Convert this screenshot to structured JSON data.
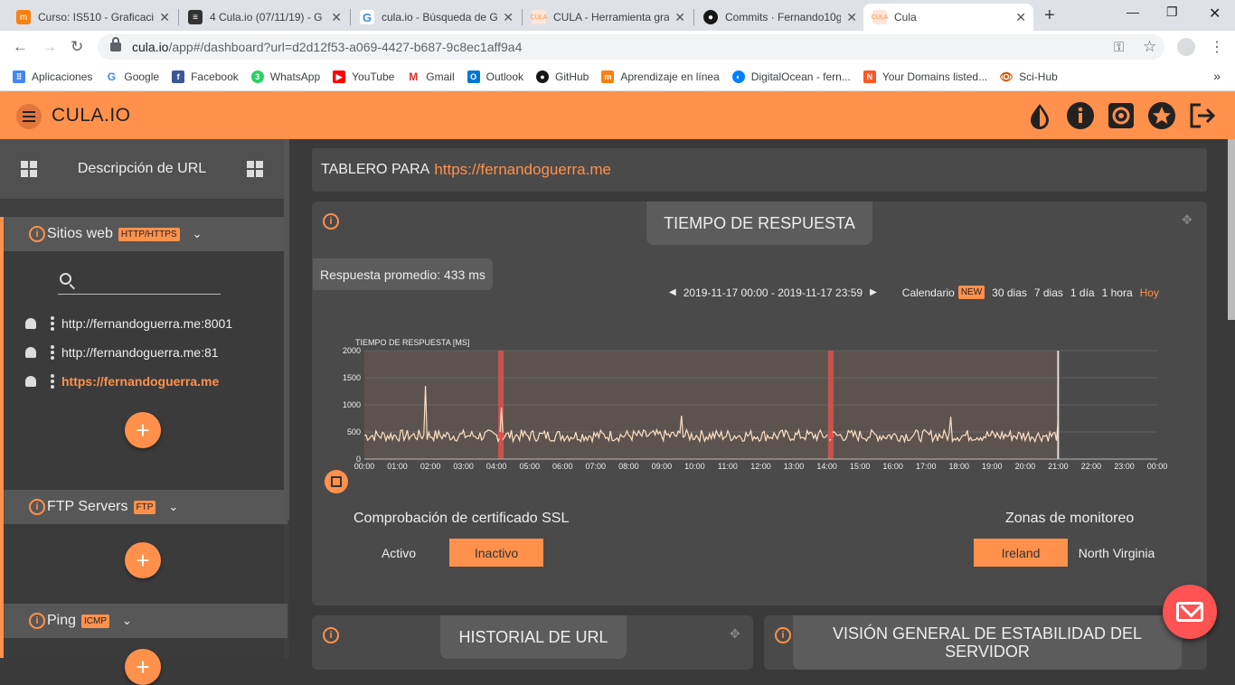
{
  "browser": {
    "tabs": [
      {
        "title": "Curso: IS510 - Graficació",
        "icon": "moodle-icon",
        "color": "#f98012"
      },
      {
        "title": "4 Cula.io (07/11/19) - G",
        "icon": "docs-icon",
        "color": "#333333"
      },
      {
        "title": "cula.io - Búsqueda de G",
        "icon": "google-icon",
        "color": "#4285f4"
      },
      {
        "title": "CULA - Herramienta gra",
        "icon": "cula-icon",
        "color": "#ff914d"
      },
      {
        "title": "Commits · Fernando10g",
        "icon": "github-icon",
        "color": "#181717"
      },
      {
        "title": "Cula",
        "icon": "cula-icon",
        "color": "#ff914d"
      }
    ],
    "url_host": "cula.io",
    "url_path": "/app#/dashboard?url=d2d12f53-a069-4427-b687-9c8ec1aff9a4",
    "bookmarks": [
      {
        "label": "Aplicaciones",
        "icon": "apps-grid-icon",
        "color": "#4285f4"
      },
      {
        "label": "Google",
        "icon": "google-icon",
        "color": "#4285f4"
      },
      {
        "label": "Facebook",
        "icon": "facebook-icon",
        "color": "#3b5998"
      },
      {
        "label": "WhatsApp",
        "icon": "whatsapp-icon",
        "color": "#25d366"
      },
      {
        "label": "YouTube",
        "icon": "youtube-icon",
        "color": "#ff0000"
      },
      {
        "label": "Gmail",
        "icon": "gmail-icon",
        "color": "#d93025"
      },
      {
        "label": "Outlook",
        "icon": "outlook-icon",
        "color": "#0078d4"
      },
      {
        "label": "GitHub",
        "icon": "github-icon",
        "color": "#181717"
      },
      {
        "label": "Aprendizaje en línea",
        "icon": "moodle-icon",
        "color": "#f98012"
      },
      {
        "label": "DigitalOcean - fern...",
        "icon": "digitalocean-icon",
        "color": "#0080ff"
      },
      {
        "label": "Your Domains listed...",
        "icon": "namecheap-icon",
        "color": "#ff5722"
      },
      {
        "label": "Sci-Hub",
        "icon": "scihub-icon",
        "color": "#d35400"
      }
    ],
    "bookmarks_more": "»"
  },
  "app": {
    "brand": "CULA.IO",
    "accent": "#ff914d",
    "toolbar_icons": [
      "theme-drop-icon",
      "info-icon",
      "settings-gear-icon",
      "star-icon",
      "logout-icon"
    ]
  },
  "sidebar": {
    "title": "Descripción de URL",
    "websites": {
      "title": "Sitios web",
      "badge": "HTTP/HTTPS",
      "items": [
        {
          "label": "http://fernandoguerra.me:8001",
          "active": false
        },
        {
          "label": "http://fernandoguerra.me:81",
          "active": false
        },
        {
          "label": "https://fernandoguerra.me",
          "active": true
        }
      ]
    },
    "ftp": {
      "title": "FTP Servers",
      "badge": "FTP"
    },
    "ping": {
      "title": "Ping",
      "badge": "ICMP"
    },
    "add_label": "+"
  },
  "dashboard": {
    "title_prefix": "TABLERO PARA",
    "title_url": "https://fernandoguerra.me",
    "response_card": {
      "title": "TIEMPO DE RESPUESTA",
      "average": "Respuesta promedio: 433 ms",
      "range_text": "2019-11-17 00:00 - 2019-11-17 23:59",
      "range_prev": "◀",
      "range_next": "▶",
      "calendar": "Calendario",
      "new_badge": "NEW",
      "ranges": [
        "30 dias",
        "7 dias",
        "1 día",
        "1 hora"
      ],
      "today": "Hoy",
      "ssl_heading": "Comprobación de certificado SSL",
      "ssl_options": [
        {
          "label": "Activo",
          "selected": false
        },
        {
          "label": "Inactivo",
          "selected": true
        }
      ],
      "zones_heading": "Zonas de monitoreo",
      "zone_options": [
        {
          "label": "Ireland",
          "selected": true
        },
        {
          "label": "North Virginia",
          "selected": false
        }
      ]
    },
    "history_card": {
      "title": "HISTORIAL DE URL"
    },
    "stability_card": {
      "title": "VISIÓN GENERAL DE ESTABILIDAD DEL SERVIDOR"
    }
  },
  "chart_data": {
    "type": "line",
    "title": "",
    "ylabel": "TIEMPO DE RESPUESTA [MS]",
    "xlabel": "",
    "ylim": [
      0,
      2000
    ],
    "yticks": [
      0,
      500,
      1000,
      1500,
      2000
    ],
    "xticks": [
      "00:00",
      "01:00",
      "02:00",
      "03:00",
      "04:00",
      "05:00",
      "06:00",
      "07:00",
      "08:00",
      "09:00",
      "10:00",
      "11:00",
      "12:00",
      "13:00",
      "14:00",
      "15:00",
      "16:00",
      "17:00",
      "18:00",
      "19:00",
      "20:00",
      "21:00",
      "22:00",
      "23:00",
      "00:00"
    ],
    "baseline_ms": 433,
    "spikes": [
      {
        "time": "01:50",
        "value": 1350
      },
      {
        "time": "04:10",
        "value": 950
      },
      {
        "time": "09:35",
        "value": 800
      },
      {
        "time": "17:45",
        "value": 780
      },
      {
        "time": "21:00",
        "value": 700
      }
    ],
    "incidents": [
      "04:08",
      "14:07"
    ],
    "data_end": "21:00",
    "line_color": "#ffe0c4",
    "incident_color": "#d9534f",
    "grid": true
  }
}
